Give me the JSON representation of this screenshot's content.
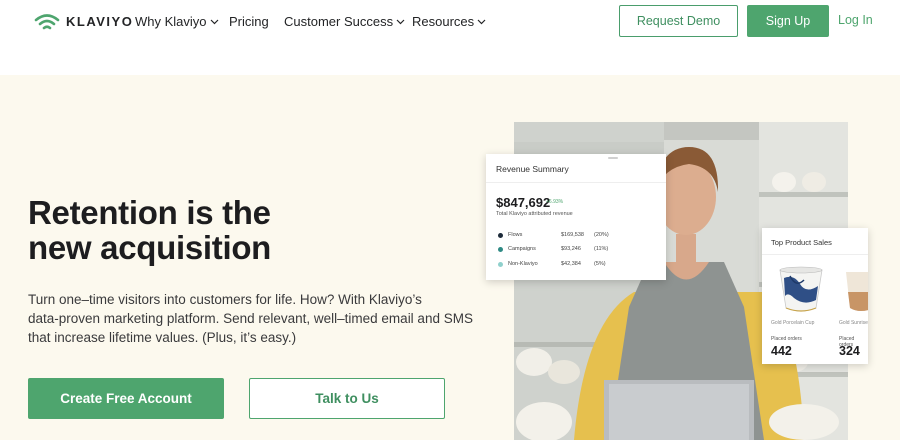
{
  "nav": {
    "brand": "KLAVIYO",
    "items": [
      {
        "label": "Why Klaviyo",
        "dropdown": true
      },
      {
        "label": "Pricing",
        "dropdown": false
      },
      {
        "label": "Customer Success",
        "dropdown": true
      },
      {
        "label": "Resources",
        "dropdown": true
      }
    ],
    "request_demo": "Request Demo",
    "sign_up": "Sign Up",
    "login": "Log In"
  },
  "hero": {
    "headline_line1": "Retention is the",
    "headline_line2": "new acquisition",
    "subtext_line1": "Turn one–time visitors into customers for life. How? With Klaviyo’s",
    "subtext_line2": "data-proven marketing platform. Send relevant, well–timed email and SMS",
    "subtext_line3": "that increase lifetime values. (Plus, it’s easy.)",
    "cta_primary": "Create Free Account",
    "cta_secondary": "Talk to Us"
  },
  "revenue_card": {
    "title": "Revenue Summary",
    "amount": "$847,692",
    "change": "+6.93%",
    "subtitle": "Total Klaviyo attributed revenue",
    "rows": [
      {
        "name": "Flows",
        "value": "$169,538",
        "percent": "(20%)",
        "color": "#1d2b3a"
      },
      {
        "name": "Campaigns",
        "value": "$93,246",
        "percent": "(11%)",
        "color": "#2f8a84"
      },
      {
        "name": "Non-Klaviyo",
        "value": "$42,384",
        "percent": "(5%)",
        "color": "#8fd0cc"
      }
    ]
  },
  "product_card": {
    "title": "Top Product Sales",
    "products": [
      {
        "name": "Gold Porcelain Cup",
        "label": "Placed orders",
        "value": "442"
      },
      {
        "name": "Gold Sunrise",
        "label": "Placed orders",
        "value": "324"
      }
    ]
  },
  "colors": {
    "accent": "#4ea56e",
    "hero_bg": "#fcf9ee"
  }
}
